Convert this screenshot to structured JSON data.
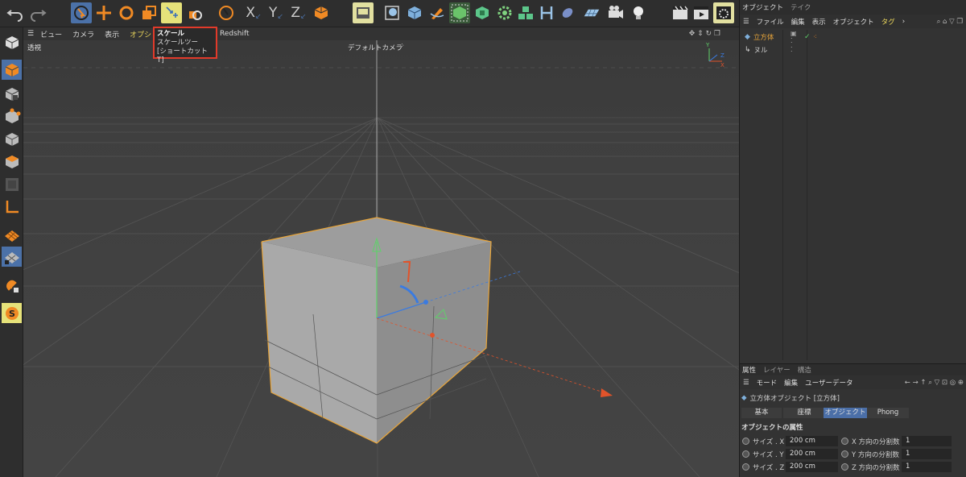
{
  "toolbar": {
    "axis_x": "X",
    "axis_y": "Y",
    "axis_z": "Z",
    "icons": [
      "undo-icon",
      "redo-icon",
      "select-icon",
      "move-icon",
      "rotate-icon",
      "scale-icon",
      "scale-tool-icon",
      "live-select-icon",
      "x-axis-icon",
      "y-axis-icon",
      "z-axis-icon",
      "coordinate-icon",
      "render-view-icon",
      "cube-icon",
      "pen-icon",
      "subdivision-icon",
      "extrude-icon",
      "cloner-icon",
      "deformer-icon",
      "camera-icon",
      "light-icon",
      "render-icon"
    ]
  },
  "tooltip": {
    "title": "スケール",
    "line2": "スケールツー",
    "shortcut": "[ショートカット T]"
  },
  "viewport_menu": {
    "items": [
      "ビュー",
      "カメラ",
      "表示",
      "オプション"
    ],
    "redshift": "Redshift",
    "view_label": "透視",
    "camera_label": "デフォルトカメラ",
    "camera_icon": "camera-dots-icon"
  },
  "object_manager": {
    "tabs": [
      "オブジェクト",
      "テイク"
    ],
    "menu": [
      "ファイル",
      "編集",
      "表示",
      "オブジェクト",
      "タグ"
    ],
    "objects": [
      {
        "name": "立方体",
        "icon": "cube-icon",
        "color": "#e8a53a"
      },
      {
        "name": "ヌル",
        "icon": "null-icon",
        "color": "#dddddd"
      }
    ]
  },
  "attribute_manager": {
    "tabs": [
      "属性",
      "レイヤー",
      "構造"
    ],
    "menu": [
      "モード",
      "編集",
      "ユーザーデータ"
    ],
    "object_title": "立方体オブジェクト [立方体]",
    "subtabs": [
      "基本",
      "座標",
      "オブジェクト",
      "Phong"
    ],
    "selected_subtab": "オブジェクト",
    "section_title": "オブジェクトの属性",
    "rows": [
      {
        "label": "サイズ . X",
        "value": "200 cm",
        "seg_label": "X 方向の分割数",
        "seg_value": "1"
      },
      {
        "label": "サイズ . Y",
        "value": "200 cm",
        "seg_label": "Y 方向の分割数",
        "seg_value": "1"
      },
      {
        "label": "サイズ . Z",
        "value": "200 cm",
        "seg_label": "Z 方向の分割数",
        "seg_value": "1"
      }
    ]
  },
  "colors": {
    "accent": "#4b71a8",
    "highlight": "#e6e27a",
    "selection_orange": "#e8a53a",
    "tooltip_border": "#e23a2a"
  }
}
